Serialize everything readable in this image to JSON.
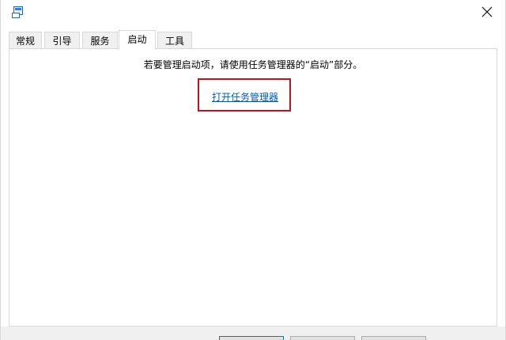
{
  "window": {
    "icon": "msconfig-icon"
  },
  "tabs": [
    {
      "label": "常规"
    },
    {
      "label": "引导"
    },
    {
      "label": "服务"
    },
    {
      "label": "启动",
      "active": true
    },
    {
      "label": "工具"
    }
  ],
  "startup": {
    "message": "若要管理启动项，请使用任务管理器的“启动”部分。",
    "link_text": "打开任务管理器"
  },
  "highlight_color": "#c1121f",
  "link_color": "#0a58b5"
}
